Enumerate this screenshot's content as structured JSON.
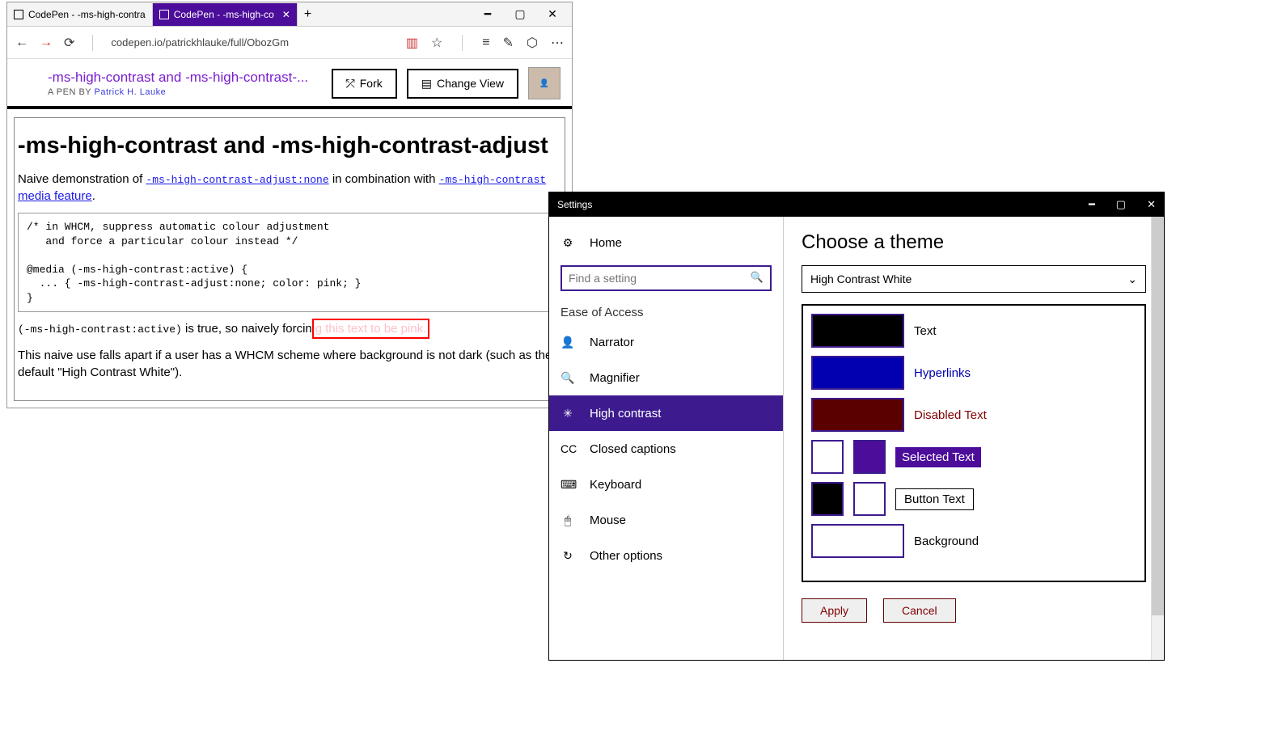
{
  "browser": {
    "tabs": [
      {
        "title": "CodePen - -ms-high-contra",
        "active": false
      },
      {
        "title": "CodePen - -ms-high-co",
        "active": true
      }
    ],
    "url": "codepen.io/patrickhlauke/full/ObozGm",
    "pen": {
      "title": "-ms-high-contrast and -ms-high-contrast-...",
      "by_prefix": "A PEN BY ",
      "author": "Patrick H. Lauke",
      "fork": "Fork",
      "change_view": "Change View"
    }
  },
  "page": {
    "heading": "-ms-high-contrast and -ms-high-contrast-adjust",
    "intro_1": "Naive demonstration of ",
    "intro_link1": "-ms-high-contrast-adjust:none",
    "intro_2": " in combination with ",
    "intro_link2": "-ms-high-contrast",
    "intro_link2b": " media feature",
    "intro_3": ".",
    "code": "/* in WHCM, suppress automatic colour adjustment\n   and force a particular colour instead */\n\n@media (-ms-high-contrast:active) {\n  ... { -ms-high-contrast-adjust:none; color: pink; }\n}",
    "p2_a": "(-ms-high-contrast:active)",
    "p2_b": " is true, so naively forcin",
    "p2_pink": "g this text to be pink.",
    "p3": "This naive use falls apart if a user has a WHCM scheme where background is not dark (such as the default \"High Contrast White\")."
  },
  "settings": {
    "title": "Settings",
    "search_placeholder": "Find a setting",
    "nav": {
      "home": "Home",
      "section": "Ease of Access",
      "items": [
        "Narrator",
        "Magnifier",
        "High contrast",
        "Closed captions",
        "Keyboard",
        "Mouse",
        "Other options"
      ]
    },
    "theme": {
      "heading": "Choose a theme",
      "selected": "High Contrast White",
      "rows": [
        {
          "label": "Text",
          "color": "#000000",
          "text_color": "#000"
        },
        {
          "label": "Hyperlinks",
          "color": "#0000b0",
          "text_color": "#0000b0"
        },
        {
          "label": "Disabled Text",
          "color": "#5a0000",
          "text_color": "#800000"
        }
      ],
      "selected_text": {
        "label": "Selected Text",
        "fg": "#ffffff",
        "bg": "#4b0d9a"
      },
      "button_text": {
        "label": "Button Text",
        "fg": "#000000",
        "bg": "#ffffff"
      },
      "background": {
        "label": "Background",
        "color": "#ffffff"
      },
      "apply": "Apply",
      "cancel": "Cancel"
    }
  }
}
